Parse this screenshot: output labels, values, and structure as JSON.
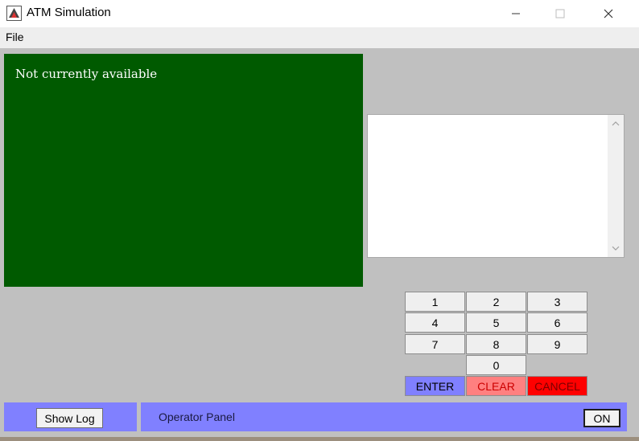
{
  "window": {
    "title": "ATM Simulation",
    "icon": "java-app-icon",
    "controls": [
      "minimize-icon",
      "maximize-icon",
      "close-icon"
    ]
  },
  "menu": {
    "file": "File"
  },
  "display": {
    "message": "Not currently available",
    "background": "#005a00"
  },
  "receipt": {
    "text": ""
  },
  "keypad": {
    "keys": [
      "1",
      "2",
      "3",
      "4",
      "5",
      "6",
      "7",
      "8",
      "9",
      "0"
    ],
    "enter": "ENTER",
    "clear": "CLEAR",
    "cancel": "CANCEL"
  },
  "log": {
    "show_log": "Show Log"
  },
  "operator": {
    "label": "Operator Panel",
    "switch": "ON"
  },
  "colors": {
    "panel": "#8080ff",
    "enter": "#8080ff",
    "clear": "#ff8080",
    "cancel": "#ff0000"
  }
}
